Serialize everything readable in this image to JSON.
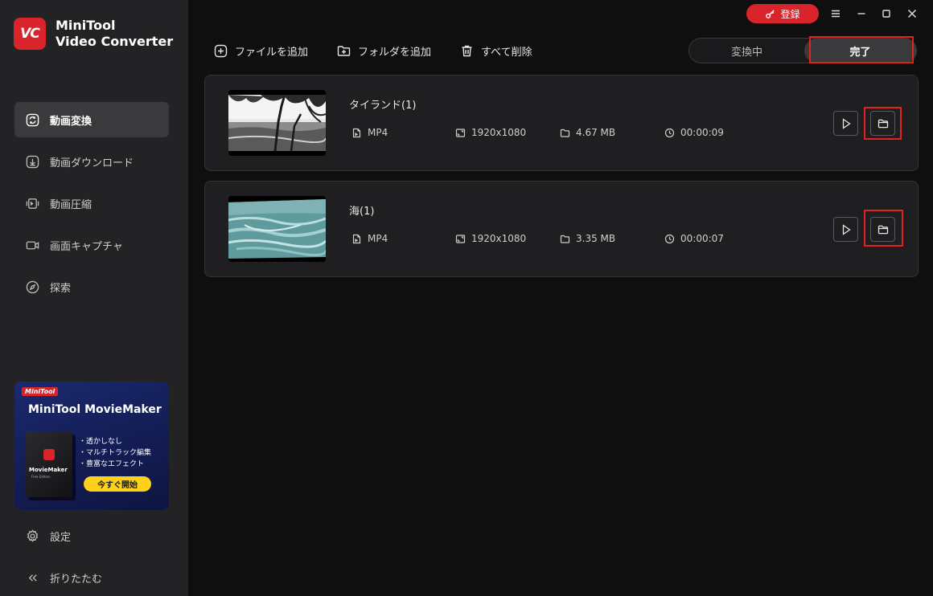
{
  "app": {
    "logo_mark": "VC",
    "name_line1": "MiniTool",
    "name_line2": "Video Converter"
  },
  "window": {
    "register_label": "登録"
  },
  "sidebar": {
    "items": [
      {
        "label": "動画変換",
        "icon": "convert-icon",
        "active": true
      },
      {
        "label": "動画ダウンロード",
        "icon": "download-icon"
      },
      {
        "label": "動画圧縮",
        "icon": "compress-icon"
      },
      {
        "label": "画面キャプチャ",
        "icon": "camera-icon"
      },
      {
        "label": "探索",
        "icon": "compass-icon"
      }
    ],
    "settings_label": "設定",
    "collapse_label": "折りたたむ"
  },
  "promo": {
    "badge": "MiniTool",
    "title": "MiniTool MovieMaker",
    "box_label": "MovieMaker",
    "box_sub": "Free Edition",
    "features": [
      "・透かしなし",
      "・マルチトラック編集",
      "・豊富なエフェクト"
    ],
    "cta": "今すぐ開始"
  },
  "toolbar": {
    "add_file": "ファイルを追加",
    "add_folder": "フォルダを追加",
    "delete_all": "すべて削除"
  },
  "tabs": {
    "converting": "変換中",
    "done": "完了"
  },
  "files": [
    {
      "name": "タイランド(1)",
      "format": "MP4",
      "resolution": "1920x1080",
      "size": "4.67 MB",
      "duration": "00:00:09"
    },
    {
      "name": "海(1)",
      "format": "MP4",
      "resolution": "1920x1080",
      "size": "3.35 MB",
      "duration": "00:00:07"
    }
  ],
  "colors": {
    "accent_red": "#d8242a",
    "highlight": "#e0231f",
    "promo_cta": "#ffd21a"
  }
}
